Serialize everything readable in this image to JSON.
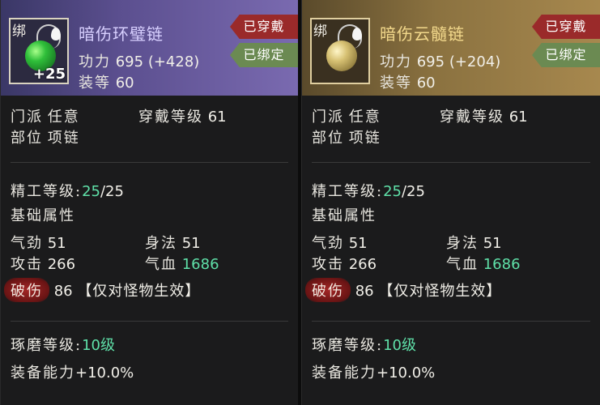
{
  "cards": [
    {
      "bind_mark": "绑",
      "plus": "+25",
      "name": "暗伤环璧链",
      "power_label": "功力",
      "power_value": "695",
      "power_bonus": "(+428)",
      "gear_score_label": "装等",
      "gear_score_value": "60",
      "tag_worn": "已穿戴",
      "tag_bound": "已绑定",
      "sect_label": "门派",
      "sect_value": "任意",
      "req_level_label": "穿戴等级",
      "req_level_value": "61",
      "slot_label": "部位",
      "slot_value": "项链",
      "refine_label": "精工等级:",
      "refine_current": "25",
      "refine_max": "/25",
      "base_attr_title": "基础属性",
      "attrs": [
        {
          "label": "气劲",
          "value": "51"
        },
        {
          "label": "身法",
          "value": "51"
        },
        {
          "label": "攻击",
          "value": "266"
        },
        {
          "label": "气血",
          "value": "1686"
        }
      ],
      "pierce_label": "破伤",
      "pierce_value": "86",
      "pierce_note": "【仅对怪物生效】",
      "polish_label": "琢磨等级:",
      "polish_value": "10级",
      "ability_label": "装备能力",
      "ability_value": "+10.0%"
    },
    {
      "bind_mark": "绑",
      "plus": "",
      "name": "暗伤云髓链",
      "power_label": "功力",
      "power_value": "695",
      "power_bonus": "(+204)",
      "gear_score_label": "装等",
      "gear_score_value": "60",
      "tag_worn": "已穿戴",
      "tag_bound": "已绑定",
      "sect_label": "门派",
      "sect_value": "任意",
      "req_level_label": "穿戴等级",
      "req_level_value": "61",
      "slot_label": "部位",
      "slot_value": "项链",
      "refine_label": "精工等级:",
      "refine_current": "25",
      "refine_max": "/25",
      "base_attr_title": "基础属性",
      "attrs": [
        {
          "label": "气劲",
          "value": "51"
        },
        {
          "label": "身法",
          "value": "51"
        },
        {
          "label": "攻击",
          "value": "266"
        },
        {
          "label": "气血",
          "value": "1686"
        }
      ],
      "pierce_label": "破伤",
      "pierce_value": "86",
      "pierce_note": "【仅对怪物生效】",
      "polish_label": "琢磨等级:",
      "polish_value": "10级",
      "ability_label": "装备能力",
      "ability_value": "+10.0%"
    }
  ],
  "colors": {
    "highlight_green": "#5fe0a8",
    "tag_worn": "#9a2a2a",
    "tag_bound": "#6b8a52",
    "card1_header": "#5b4f8f",
    "card2_header": "#8b7240"
  },
  "icons": [
    "jade-necklace-icon",
    "amber-necklace-icon"
  ]
}
